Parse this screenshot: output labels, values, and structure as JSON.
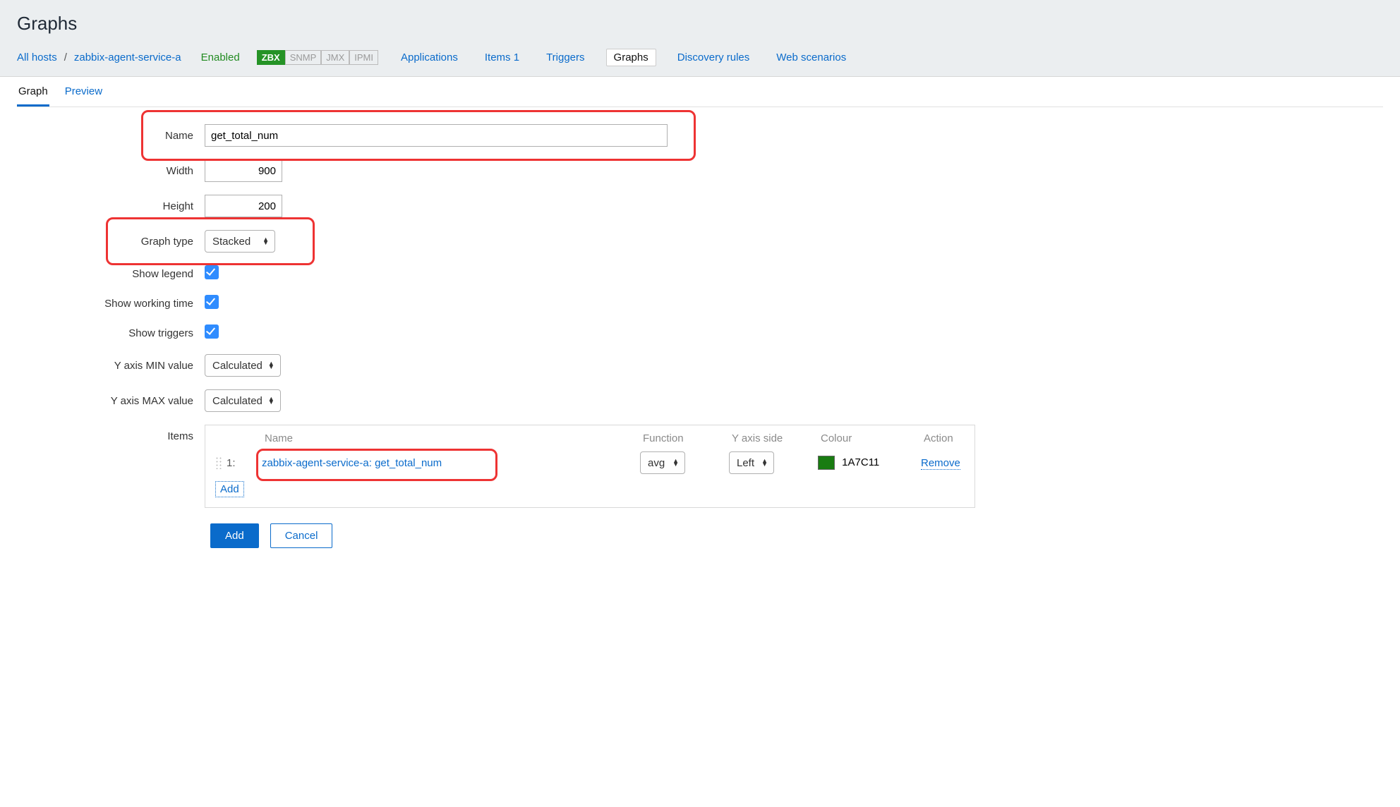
{
  "page": {
    "title": "Graphs"
  },
  "breadcrumb": {
    "all_hosts": "All hosts",
    "sep": "/",
    "host": "zabbix-agent-service-a",
    "enabled": "Enabled",
    "badges": {
      "zbx": "ZBX",
      "snmp": "SNMP",
      "jmx": "JMX",
      "ipmi": "IPMI"
    },
    "nav": {
      "applications": "Applications",
      "items": "Items 1",
      "triggers": "Triggers",
      "graphs": "Graphs",
      "discovery": "Discovery rules",
      "web": "Web scenarios"
    }
  },
  "tabs": {
    "graph": "Graph",
    "preview": "Preview"
  },
  "form": {
    "labels": {
      "name": "Name",
      "width": "Width",
      "height": "Height",
      "graph_type": "Graph type",
      "show_legend": "Show legend",
      "show_working_time": "Show working time",
      "show_triggers": "Show triggers",
      "y_min": "Y axis MIN value",
      "y_max": "Y axis MAX value",
      "items": "Items"
    },
    "values": {
      "name": "get_total_num",
      "width": "900",
      "height": "200",
      "graph_type": "Stacked",
      "y_min": "Calculated",
      "y_max": "Calculated"
    }
  },
  "items_table": {
    "headers": {
      "name": "Name",
      "function": "Function",
      "y_side": "Y axis side",
      "colour": "Colour",
      "action": "Action"
    },
    "rows": [
      {
        "index": "1:",
        "name": "zabbix-agent-service-a: get_total_num",
        "function": "avg",
        "y_side": "Left",
        "colour": "1A7C11",
        "action": "Remove"
      }
    ],
    "add": "Add"
  },
  "buttons": {
    "add": "Add",
    "cancel": "Cancel"
  }
}
